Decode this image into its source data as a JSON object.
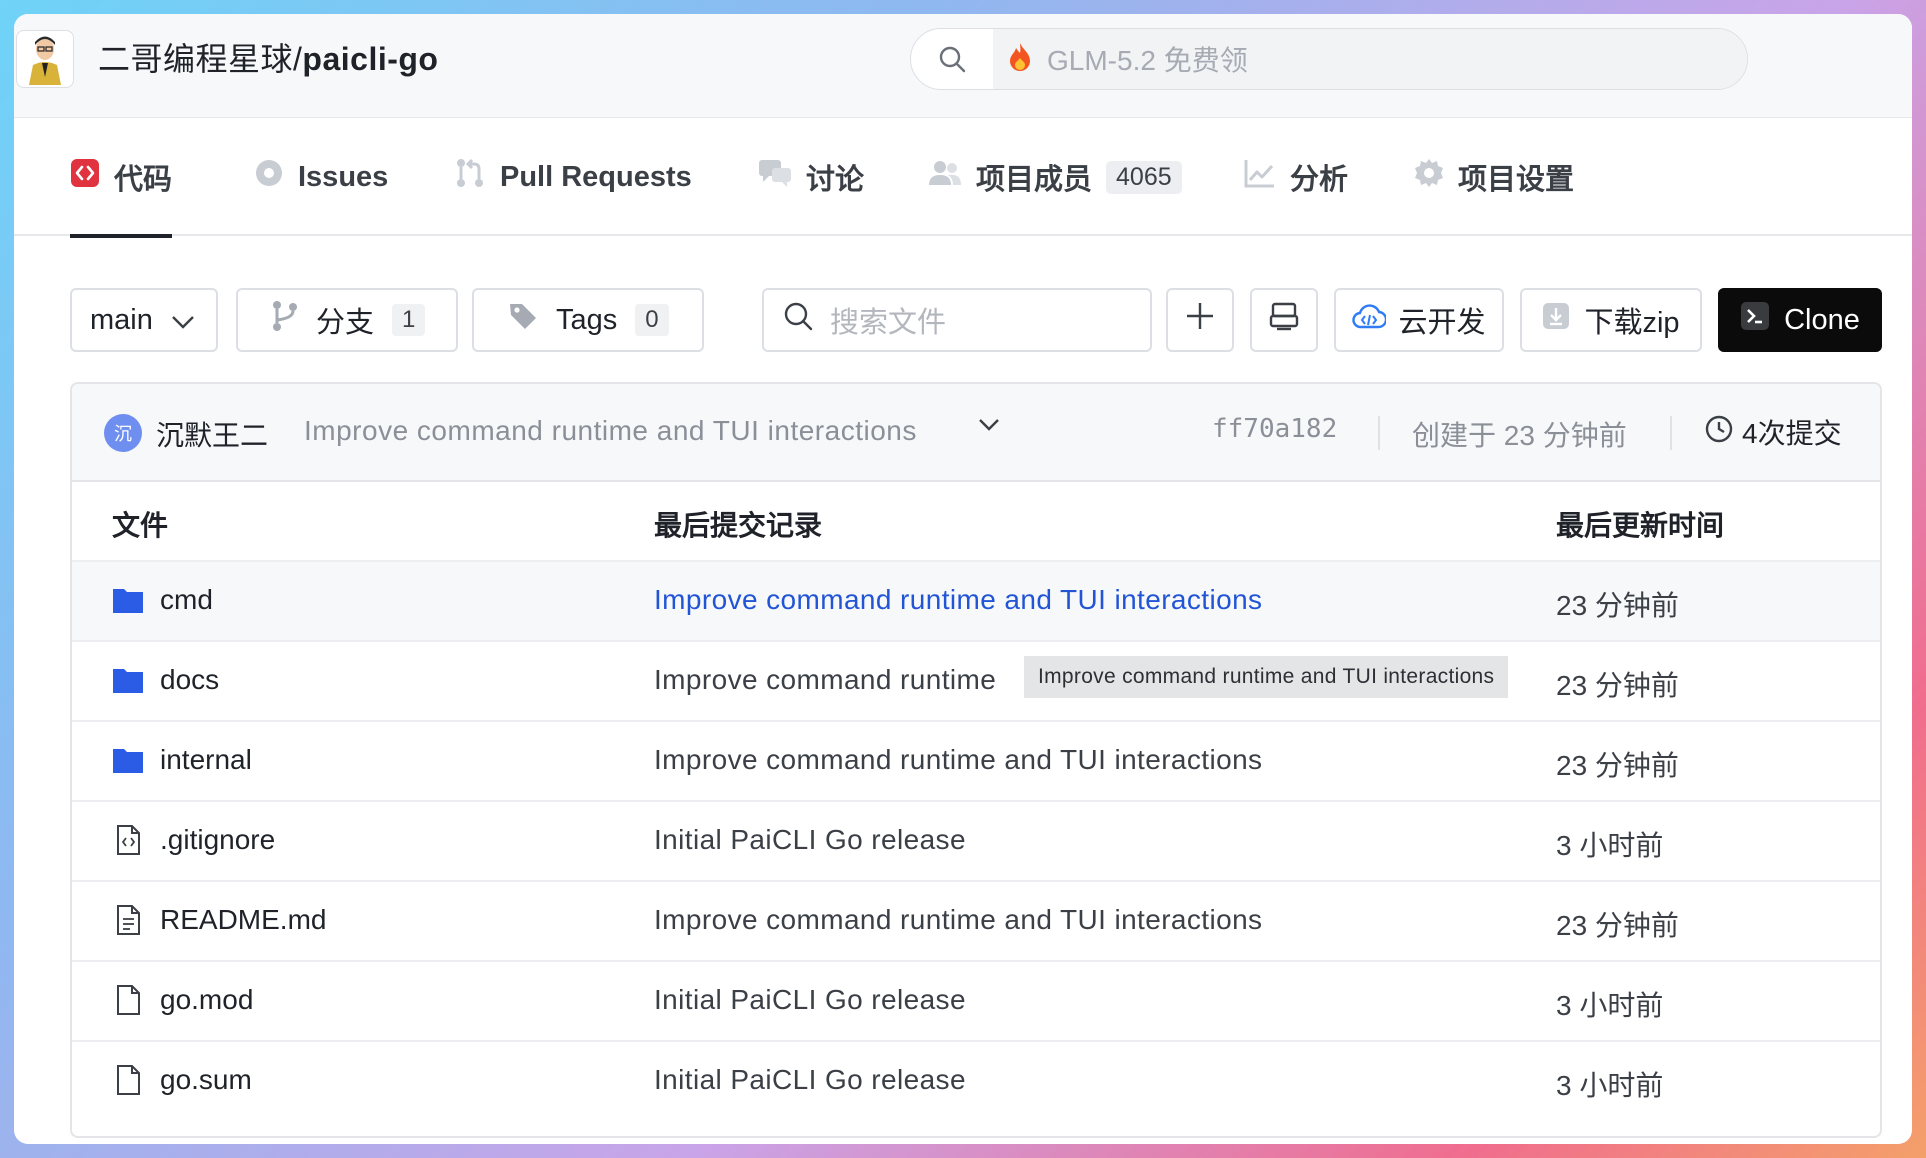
{
  "header": {
    "repo_owner": "二哥编程星球/",
    "repo_name": "paicli-go",
    "search_placeholder": "GLM-5.2 免费领"
  },
  "nav": {
    "tabs": [
      {
        "label": "代码"
      },
      {
        "label": "Issues"
      },
      {
        "label": "Pull Requests"
      },
      {
        "label": "讨论"
      },
      {
        "label": "项目成员",
        "badge": "4065"
      },
      {
        "label": "分析"
      },
      {
        "label": "项目设置"
      }
    ]
  },
  "toolbar": {
    "branch": "main",
    "branches_label": "分支",
    "branches_count": "1",
    "tags_label": "Tags",
    "tags_count": "0",
    "file_search_placeholder": "搜索文件",
    "cloud_dev_label": "云开发",
    "download_label": "下载zip",
    "clone_label": "Clone"
  },
  "commit_bar": {
    "avatar_char": "沉",
    "author": "沉默王二",
    "message": "Improve command runtime and TUI interactions",
    "sha": "ff70a182",
    "created": "创建于 23 分钟前",
    "commits": "4次提交"
  },
  "table": {
    "headers": [
      "文件",
      "最后提交记录",
      "最后更新时间"
    ],
    "rows": [
      {
        "name": "cmd",
        "type": "folder",
        "message": "Improve command runtime and TUI interactions",
        "time": "23 分钟前"
      },
      {
        "name": "docs",
        "type": "folder",
        "message": "Improve command runtime",
        "time": "23 分钟前"
      },
      {
        "name": "internal",
        "type": "folder",
        "message": "Improve command runtime and TUI interactions",
        "time": "23 分钟前"
      },
      {
        "name": ".gitignore",
        "type": "code-file",
        "message": "Initial PaiCLI Go release",
        "time": "3 小时前"
      },
      {
        "name": "README.md",
        "type": "text-file",
        "message": "Improve command runtime and TUI interactions",
        "time": "23 分钟前"
      },
      {
        "name": "go.mod",
        "type": "file",
        "message": "Initial PaiCLI Go release",
        "time": "3 小时前"
      },
      {
        "name": "go.sum",
        "type": "file",
        "message": "Initial PaiCLI Go release",
        "time": "3 小时前"
      }
    ],
    "tooltip": "Improve command runtime and TUI interactions"
  },
  "colors": {
    "accent_link": "#2155d6",
    "folder": "#2b5ce6",
    "code_tab_icon": "#e0323f",
    "clone_bg": "#0b0b0c"
  }
}
